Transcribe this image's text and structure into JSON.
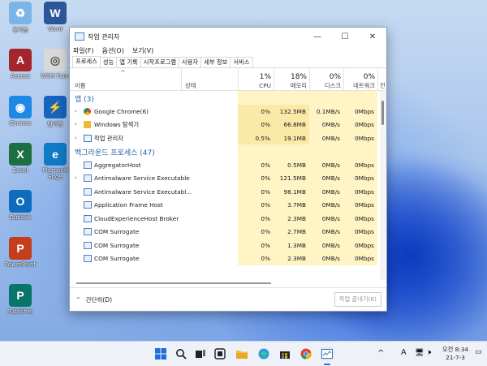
{
  "desktop": {
    "icons": [
      {
        "label": "휴지통",
        "icon": "recycle-bin-icon",
        "color": "#7bb4e6"
      },
      {
        "label": "Access",
        "icon": "access-icon",
        "color": "#a4262c"
      },
      {
        "label": "Chrome",
        "icon": "chrome-icon",
        "color": "#1e88e5"
      },
      {
        "label": "Excel",
        "icon": "excel-icon",
        "color": "#1d6f42"
      },
      {
        "label": "Outlook",
        "icon": "outlook-icon",
        "color": "#0f6cbd"
      },
      {
        "label": "PowerPoint",
        "icon": "powerpoint-icon",
        "color": "#c43e1c"
      },
      {
        "label": "Publisher",
        "icon": "publisher-icon",
        "color": "#077568"
      },
      {
        "label": "Word",
        "icon": "word-icon",
        "color": "#2b579a"
      },
      {
        "label": "WSM Func",
        "icon": "wsm-icon",
        "color": "#d9d9d9"
      },
      {
        "label": "단어형",
        "icon": "shortcut-icon",
        "color": "#1565c0"
      },
      {
        "label": "Microsoft Edge",
        "icon": "edge-icon",
        "color": "#0f7bc5"
      }
    ]
  },
  "window": {
    "title": "작업 관리자",
    "controls": {
      "minimize": "—",
      "maximize": "☐",
      "close": "✕"
    },
    "menu": [
      "파일(F)",
      "옵션(O)",
      "보기(V)"
    ],
    "tabs": [
      "프로세스",
      "성능",
      "앱 기록",
      "시작프로그램",
      "사용자",
      "세부 정보",
      "서비스"
    ],
    "active_tab": "프로세스",
    "header": {
      "name": "이름",
      "status": "상태",
      "cpu_pct": "1%",
      "cpu": "CPU",
      "mem_pct": "18%",
      "mem": "메모리",
      "disk_pct": "0%",
      "disk": "디스크",
      "net_pct": "0%",
      "net": "네트워크",
      "extra": "전"
    },
    "sections": {
      "apps": "앱 (3)",
      "background": "백그라운드 프로세스 (47)"
    },
    "apps": [
      {
        "name": "Google Chrome(6)",
        "cpu": "0%",
        "mem": "132.5MB",
        "disk": "0.1MB/s",
        "net": "0Mbps",
        "icon": "chrome-icon"
      },
      {
        "name": "Windows 탐색기",
        "cpu": "0%",
        "mem": "66.8MB",
        "disk": "0MB/s",
        "net": "0Mbps",
        "icon": "folder-icon"
      },
      {
        "name": "작업 관리자",
        "cpu": "0.5%",
        "mem": "19.1MB",
        "disk": "0MB/s",
        "net": "0Mbps",
        "icon": "task-manager-icon"
      }
    ],
    "background": [
      {
        "name": "AggregatorHost",
        "cpu": "0%",
        "mem": "0.5MB",
        "disk": "0MB/s",
        "net": "0Mbps"
      },
      {
        "name": "Antimalware Service Executable",
        "cpu": "0%",
        "mem": "121.5MB",
        "disk": "0MB/s",
        "net": "0Mbps"
      },
      {
        "name": "Antimalware Service Executabl...",
        "cpu": "0%",
        "mem": "98.1MB",
        "disk": "0MB/s",
        "net": "0Mbps"
      },
      {
        "name": "Application Frame Host",
        "cpu": "0%",
        "mem": "3.7MB",
        "disk": "0MB/s",
        "net": "0Mbps"
      },
      {
        "name": "CloudExperienceHost Broker",
        "cpu": "0%",
        "mem": "2.3MB",
        "disk": "0MB/s",
        "net": "0Mbps"
      },
      {
        "name": "COM Surrogate",
        "cpu": "0%",
        "mem": "2.7MB",
        "disk": "0MB/s",
        "net": "0Mbps"
      },
      {
        "name": "COM Surrogate",
        "cpu": "0%",
        "mem": "1.3MB",
        "disk": "0MB/s",
        "net": "0Mbps"
      },
      {
        "name": "COM Surrogate",
        "cpu": "0%",
        "mem": "2.3MB",
        "disk": "0MB/s",
        "net": "0Mbps"
      }
    ],
    "footer": {
      "collapse": "간단히(D)",
      "end_task": "작업 끝내기(E)"
    }
  },
  "taskbar": {
    "clock_time": "오전 8:34",
    "clock_date": "21-7-3",
    "ime": "A",
    "tray_up": "^"
  },
  "colors": {
    "accent": "#2a62a8",
    "cell_yellow": "#fff4c4",
    "cell_yellow_strong": "#fbe9a8"
  }
}
